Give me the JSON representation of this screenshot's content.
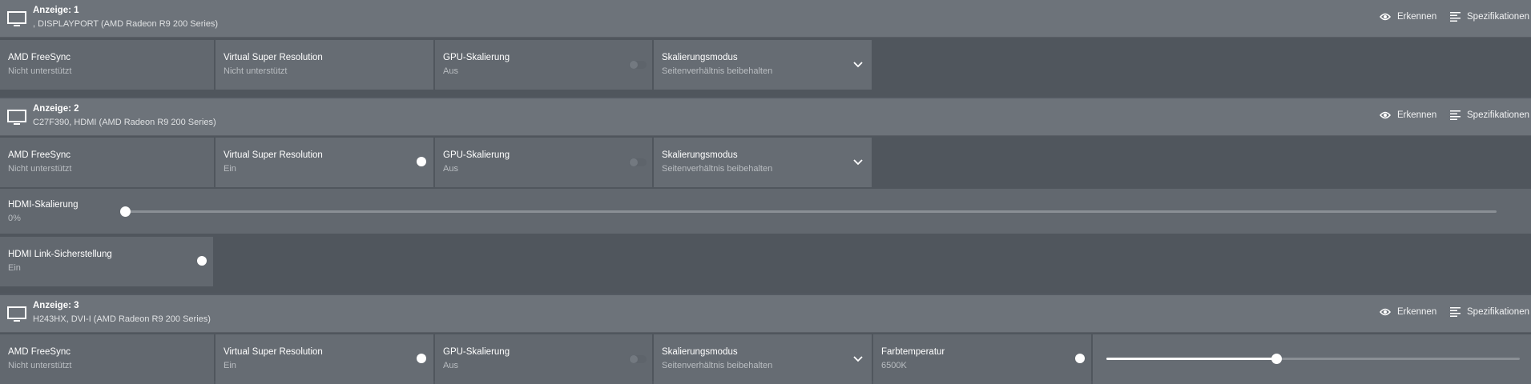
{
  "actions": {
    "identify": "Erkennen",
    "specs": "Spezifikationen"
  },
  "displays": [
    {
      "title": "Anzeige: 1",
      "subtitle": ", DISPLAYPORT (AMD Radeon R9 200 Series)",
      "freesync": {
        "label": "AMD FreeSync",
        "value": "Nicht unterstützt"
      },
      "vsr": {
        "label": "Virtual Super Resolution",
        "value": "Nicht unterstützt"
      },
      "gpu_scaling": {
        "label": "GPU-Skalierung",
        "value": "Aus"
      },
      "scaling_mode": {
        "label": "Skalierungsmodus",
        "value": "Seitenverhältnis beibehalten"
      }
    },
    {
      "title": "Anzeige: 2",
      "subtitle": "C27F390, HDMI (AMD Radeon R9 200 Series)",
      "freesync": {
        "label": "AMD FreeSync",
        "value": "Nicht unterstützt"
      },
      "vsr": {
        "label": "Virtual Super Resolution",
        "value": "Ein"
      },
      "gpu_scaling": {
        "label": "GPU-Skalierung",
        "value": "Aus"
      },
      "scaling_mode": {
        "label": "Skalierungsmodus",
        "value": "Seitenverhältnis beibehalten"
      },
      "hdmi_scaling": {
        "label": "HDMI-Skalierung",
        "value": "0%",
        "level": 0
      },
      "hdmi_link": {
        "label": "HDMI Link-Sicherstellung",
        "value": "Ein"
      }
    },
    {
      "title": "Anzeige: 3",
      "subtitle": "H243HX, DVI-I (AMD Radeon R9 200 Series)",
      "freesync": {
        "label": "AMD FreeSync",
        "value": "Nicht unterstützt"
      },
      "vsr": {
        "label": "Virtual Super Resolution",
        "value": "Ein"
      },
      "gpu_scaling": {
        "label": "GPU-Skalierung",
        "value": "Aus"
      },
      "scaling_mode": {
        "label": "Skalierungsmodus",
        "value": "Seitenverhältnis beibehalten"
      },
      "color_temp": {
        "label": "Farbtemperatur",
        "value": "6500K",
        "level": 0.41
      }
    }
  ],
  "icons": {
    "monitor": "monitor-icon",
    "eye": "eye-icon",
    "specs": "list-icon",
    "chevron": "chevron-down-icon"
  }
}
